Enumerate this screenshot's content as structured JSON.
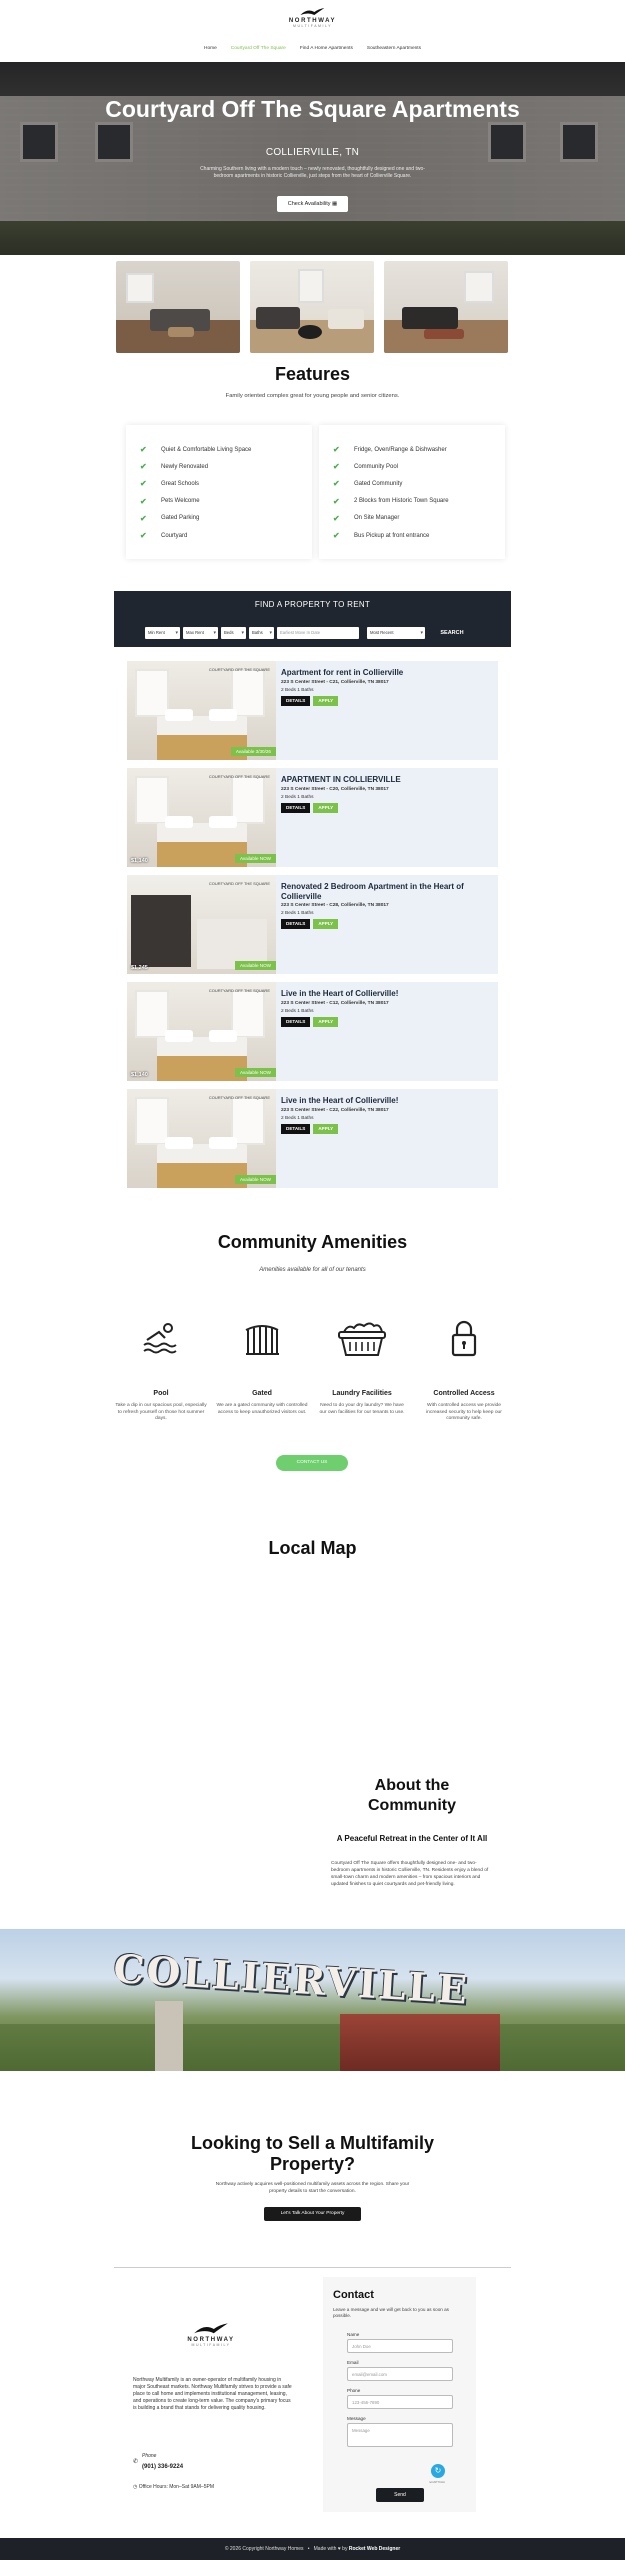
{
  "header": {
    "logo": {
      "line1": "NORTHWAY",
      "line2": "MULTIFAMILY"
    },
    "nav": [
      {
        "label": "Home",
        "active": false
      },
      {
        "label": "Courtyard Off The Square",
        "active": true
      },
      {
        "label": "Find A Home Apartments",
        "active": false
      },
      {
        "label": "Southeastern Apartments",
        "active": false
      }
    ]
  },
  "hero": {
    "title": "Courtyard Off The Square Apartments",
    "subtitle": "COLLIERVILLE, TN",
    "description": "Charming Southern living with a modern touch – newly renovated, thoughtfully designed one and two-bedroom apartments in historic Collierville, just steps from the heart of Collierville Square.",
    "button": "Check Availability"
  },
  "features": {
    "title": "Features",
    "subtitle": "Family oriented complex great for young people and senior citizens.",
    "left": [
      "Quiet & Comfortable Living Space",
      "Newly Renovated",
      "Great Schools",
      "Pets Welcome",
      "Gated Parking",
      "Courtyard"
    ],
    "right": [
      "Fridge, Oven/Range & Dishwasher",
      "Community Pool",
      "Gated Community",
      "2 Blocks from Historic Town Square",
      "On Site Manager",
      "Bus Pickup at front entrance"
    ]
  },
  "search": {
    "title": "FIND A PROPERTY TO RENT",
    "fields": [
      "Min Rent",
      "Max Rent",
      "Beds",
      "Baths",
      "Earliest Move In Date",
      "Most Recent"
    ],
    "button": "SEARCH"
  },
  "listings": [
    {
      "title": "Apartment for rent in Collierville",
      "address": "223 S Center Street - C21, Collierville, TN 38017",
      "meta": "2 Beds   1 Baths",
      "price": "",
      "available": "Available 3/30/26",
      "details": "DETAILS",
      "apply": "APPLY"
    },
    {
      "title": "APARTMENT IN COLLIERVILLE",
      "address": "223 S Center Street - C20, Collierville, TN 38017",
      "meta": "2 Beds   1 Baths",
      "price": "$1,140",
      "available": "Available NOW",
      "details": "DETAILS",
      "apply": "APPLY"
    },
    {
      "title": "Renovated 2 Bedroom Apartment in the Heart of Collierville",
      "address": "223 S Center Street - C28, Collierville, TN 38017",
      "meta": "2 Beds   1 Baths",
      "price": "$1,245",
      "available": "Available NOW",
      "details": "DETAILS",
      "apply": "APPLY"
    },
    {
      "title": "Live in the Heart of Collierville!",
      "address": "223 S Center Street - C12, Collierville, TN 38017",
      "meta": "2 Beds   1 Baths",
      "price": "$1,140",
      "available": "Available NOW",
      "details": "DETAILS",
      "apply": "APPLY"
    },
    {
      "title": "Live in the Heart of Collierville!",
      "address": "223 S Center Street - C22, Collierville, TN 38017",
      "meta": "2 Beds   1 Baths",
      "price": "",
      "available": "Available NOW",
      "details": "DETAILS",
      "apply": "APPLY"
    }
  ],
  "listing_brand": "COURTYARD OFF THE SQUARE",
  "amenities": {
    "title": "Community Amenities",
    "subtitle": "Amenities available for all of our tenants",
    "items": [
      {
        "name": "Pool",
        "icon": "pool-icon",
        "desc": "Take a dip in our spacious pool, especially to refresh yourself on those hot summer days."
      },
      {
        "name": "Gated",
        "icon": "gate-icon",
        "desc": "We are a gated community with controlled access to keep unauthorized visitors out."
      },
      {
        "name": "Laundry Facilities",
        "icon": "laundry-basket-icon",
        "desc": "Need to do your dry laundry? We have our own facilities for our tenants to use."
      },
      {
        "name": "Controlled Access",
        "icon": "padlock-icon",
        "desc": "With controlled access we provide increased security to help keep our community safe."
      }
    ],
    "button": "CONTACT US"
  },
  "map": {
    "title": "Local Map"
  },
  "about": {
    "title": "About the Community",
    "subtitle": "A Peaceful Retreat in the Center of It All",
    "body": "Courtyard Off The Square offers thoughtfully designed one- and two-bedroom apartments in historic Collierville, TN. Residents enjoy a blend of small-town charm and modern amenities – from spacious interiors and updated finishes to quiet courtyards and pet-friendly living."
  },
  "banner": {
    "text": "COLLIERVILLE"
  },
  "sell": {
    "title": "Looking to Sell a Multifamily Property?",
    "desc": "Northway actively acquires well-positioned multifamily assets across the region. Share your property details to start the conversation.",
    "button": "Let's Talk About Your Property"
  },
  "footer": {
    "desc": "Northway Multifamily is an owner-operator of multifamily housing in major Southeast markets. Northway Multifamily strives to provide a safe place to call home and implements institutional management, leasing, and operations to create long-term value. The company's primary focus is building a brand that stands for delivering quality housing.",
    "phone_label": "Phone",
    "phone": "(901) 336-9224",
    "hours": "Office Hours:  Mon–Sat 9AM–5PM"
  },
  "contact": {
    "title": "Contact",
    "subtitle": "Leave a message and we will get back to you as soon as possible.",
    "fields": [
      {
        "label": "Name",
        "placeholder": "John Doe"
      },
      {
        "label": "Email",
        "placeholder": "email@email.com"
      },
      {
        "label": "Phone",
        "placeholder": "123-456-7890"
      },
      {
        "label": "Message",
        "placeholder": "Message"
      }
    ],
    "captcha": "reCAPTCHA",
    "send": "Send"
  },
  "bottom": {
    "copyright": "© 2026 Copyright Northway Homes",
    "made_by": "Made with ♥ by",
    "agency": "Rocket Web Designer"
  },
  "colors": {
    "accent_green": "#7cc14a",
    "navy": "#20262f",
    "listing_bg": "#ecf1f7"
  }
}
